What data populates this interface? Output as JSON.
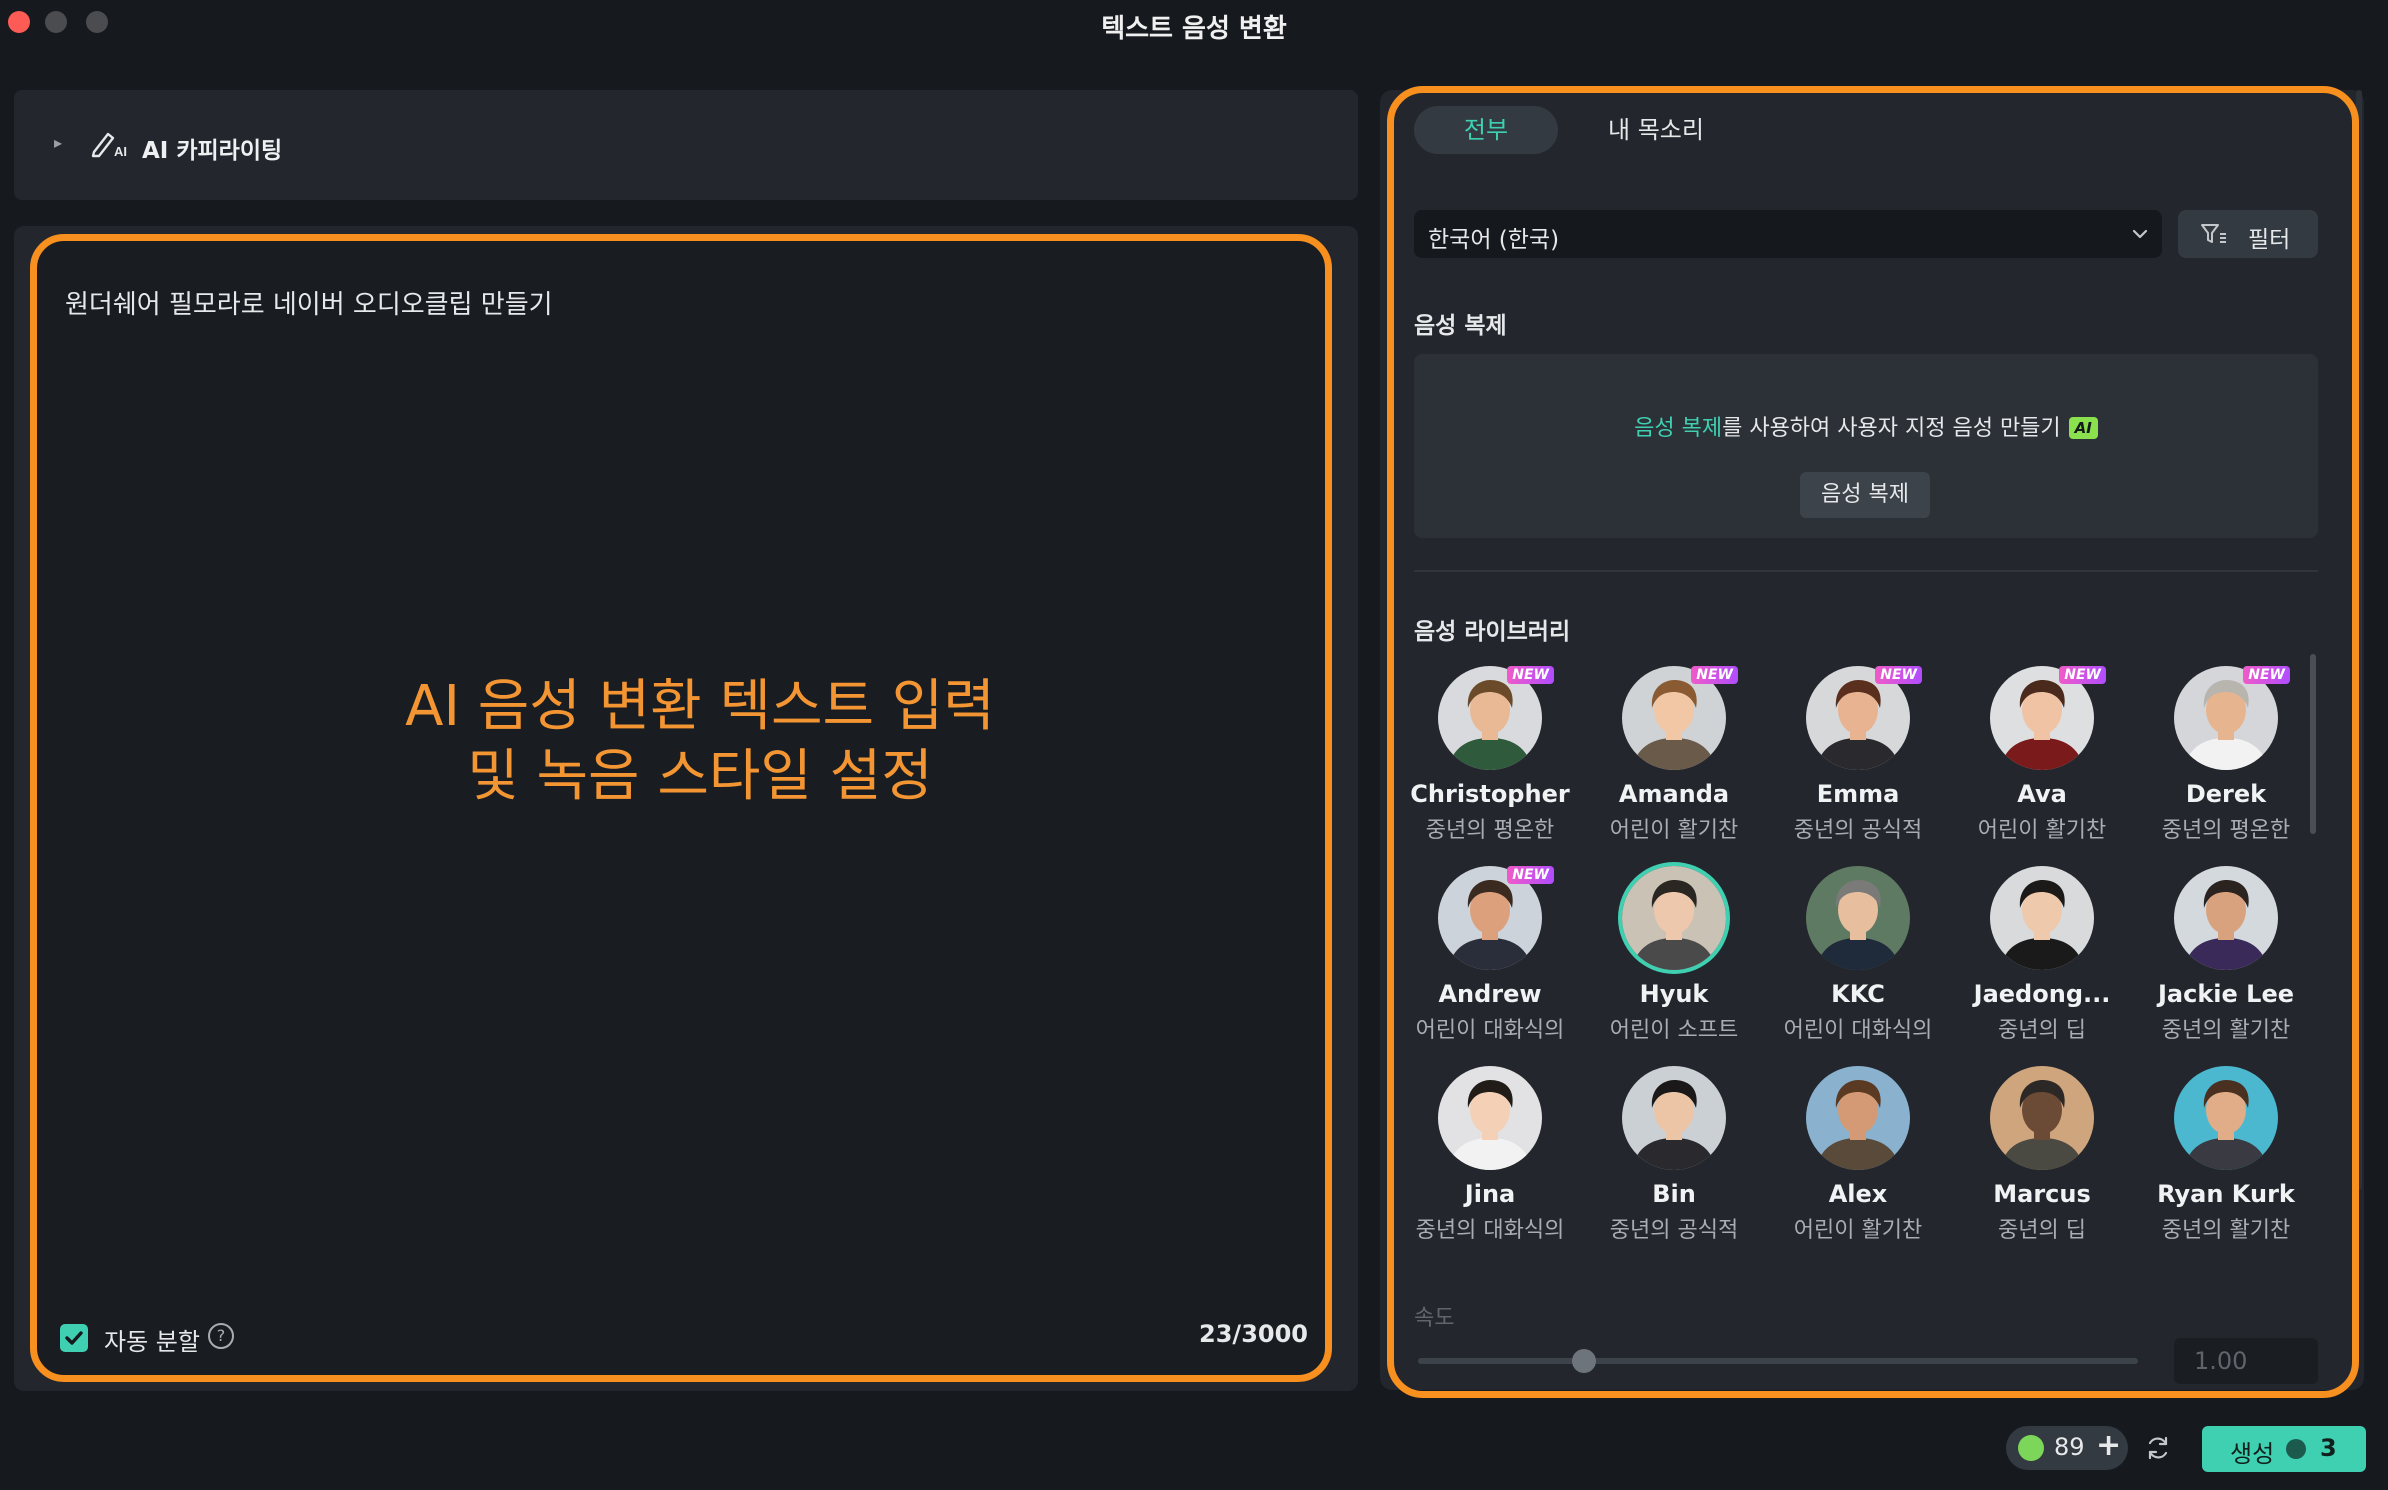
{
  "window": {
    "title": "텍스트 음성 변환"
  },
  "copywriting": {
    "label": "AI 카피라이팅"
  },
  "editor": {
    "text": "원더쉐어 필모라로 네이버 오디오클립 만들기",
    "overlay_line1": "AI 음성 변환 텍스트 입력",
    "overlay_line2": "및 녹음 스타일 설정",
    "auto_split_label": "자동 분할",
    "auto_split_checked": true,
    "help_glyph": "?",
    "char_count": "23/3000"
  },
  "tabs": [
    {
      "label": "전부",
      "active": true
    },
    {
      "label": "내 목소리",
      "active": false
    }
  ],
  "language": {
    "value": "한국어 (한국)"
  },
  "filter": {
    "label": "필터"
  },
  "voice_clone": {
    "title": "음성 복제",
    "link_text": "음성 복제",
    "rest_text": "를 사용하여 사용자 지정 음성 만들기",
    "ai_badge": "AI",
    "button_label": "음성 복제"
  },
  "library": {
    "title": "음성 라이브러리",
    "new_badge": "NEW",
    "voices": [
      {
        "name": "Christopher",
        "desc": "중년의 평온한",
        "new": true,
        "selected": false
      },
      {
        "name": "Amanda",
        "desc": "어린이 활기찬",
        "new": true,
        "selected": false
      },
      {
        "name": "Emma",
        "desc": "중년의 공식적",
        "new": true,
        "selected": false
      },
      {
        "name": "Ava",
        "desc": "어린이 활기찬",
        "new": true,
        "selected": false
      },
      {
        "name": "Derek",
        "desc": "중년의 평온한",
        "new": true,
        "selected": false
      },
      {
        "name": "Andrew",
        "desc": "어린이 대화식의",
        "new": true,
        "selected": false
      },
      {
        "name": "Hyuk",
        "desc": "어린이 소프트",
        "new": false,
        "selected": true
      },
      {
        "name": "KKC",
        "desc": "어린이 대화식의",
        "new": false,
        "selected": false
      },
      {
        "name": "Jaedong...",
        "desc": "중년의 딥",
        "new": false,
        "selected": false
      },
      {
        "name": "Jackie Lee",
        "desc": "중년의 활기찬",
        "new": false,
        "selected": false
      },
      {
        "name": "Jina",
        "desc": "중년의 대화식의",
        "new": false,
        "selected": false
      },
      {
        "name": "Bin",
        "desc": "중년의 공식적",
        "new": false,
        "selected": false
      },
      {
        "name": "Alex",
        "desc": "어린이 활기찬",
        "new": false,
        "selected": false
      },
      {
        "name": "Marcus",
        "desc": "중년의 딥",
        "new": false,
        "selected": false
      },
      {
        "name": "Ryan Kurk",
        "desc": "중년의 활기찬",
        "new": false,
        "selected": false
      }
    ]
  },
  "speed": {
    "label": "속도",
    "value": "1.00",
    "slider_fraction": 0.23
  },
  "footer": {
    "credits": "89",
    "plus": "+",
    "generate_label": "생성",
    "generate_cost": "3"
  },
  "colors": {
    "accent": "#3fd0b2",
    "highlight_outline": "#f7901e",
    "overlay_text": "#f39532"
  }
}
